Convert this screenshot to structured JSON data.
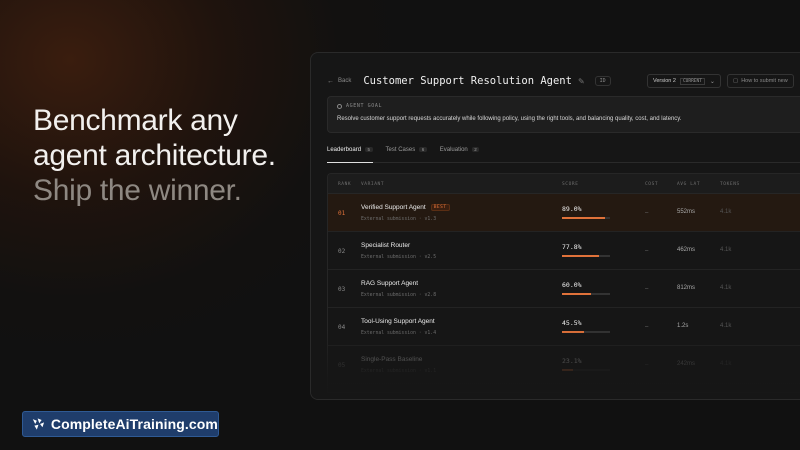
{
  "hero": {
    "line1": "Benchmark any",
    "line2": "agent architecture.",
    "line3": "Ship the winner."
  },
  "brand": {
    "label": "CompleteAiTraining.com",
    "color": "#1f3d6b"
  },
  "app": {
    "back_label": "Back",
    "title": "Customer Support Resolution Agent",
    "id_chip": "ID",
    "version_label": "Version 2",
    "version_badge": "CURRENT",
    "howto_label": "How to submit new",
    "goal": {
      "label": "AGENT GOAL",
      "text": "Resolve customer support requests accurately while following policy, using the right tools, and balancing quality, cost, and latency."
    },
    "tabs": [
      {
        "label": "Leaderboard",
        "count": "5",
        "active": true
      },
      {
        "label": "Test Cases",
        "count": "6",
        "active": false
      },
      {
        "label": "Evaluation",
        "count": "2",
        "active": false
      }
    ],
    "columns": {
      "rank": "RANK",
      "variant": "VARIANT",
      "score": "SCORE",
      "cost": "COST",
      "latency": "AVG LAT",
      "tokens": "TOKENS"
    },
    "rows": [
      {
        "rank": "01",
        "name": "Verified Support Agent",
        "badge": "BEST",
        "sub": "External submission · v1.3",
        "score": "89.0%",
        "score_value": 0.89,
        "cost": "–",
        "latency": "552ms",
        "tokens": "4.1k"
      },
      {
        "rank": "02",
        "name": "Specialist Router",
        "badge": "",
        "sub": "External submission · v2.5",
        "score": "77.8%",
        "score_value": 0.778,
        "cost": "–",
        "latency": "462ms",
        "tokens": "4.1k"
      },
      {
        "rank": "03",
        "name": "RAG Support Agent",
        "badge": "",
        "sub": "External submission · v2.8",
        "score": "60.0%",
        "score_value": 0.6,
        "cost": "–",
        "latency": "812ms",
        "tokens": "4.1k"
      },
      {
        "rank": "04",
        "name": "Tool-Using Support Agent",
        "badge": "",
        "sub": "External submission · v1.4",
        "score": "45.5%",
        "score_value": 0.455,
        "cost": "–",
        "latency": "1.2s",
        "tokens": "4.1k"
      },
      {
        "rank": "05",
        "name": "Single-Pass Baseline",
        "badge": "",
        "sub": "External submission · v1.1",
        "score": "23.1%",
        "score_value": 0.231,
        "cost": "–",
        "latency": "242ms",
        "tokens": "4.1k"
      }
    ],
    "accent_color": "#e0723a"
  }
}
